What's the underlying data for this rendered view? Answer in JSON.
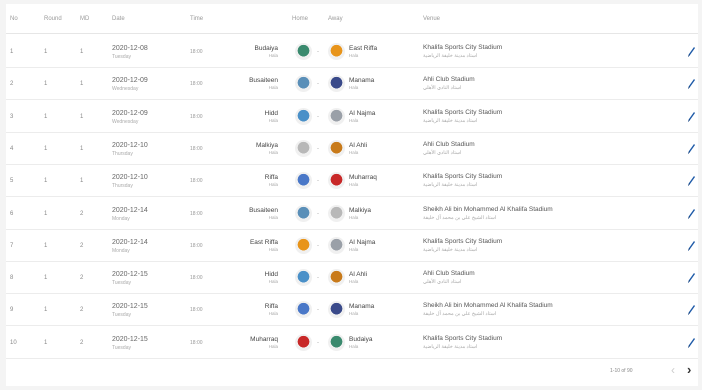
{
  "header": {
    "no": "No",
    "round": "Round",
    "md": "MD",
    "date": "Date",
    "time": "Time",
    "home": "Home",
    "away": "Away",
    "venue": "Venue"
  },
  "rows": [
    {
      "no": "1",
      "round": "1",
      "md": "1",
      "date": "2020-12-08",
      "day": "Tuesday",
      "time": "18:00",
      "home": "Budaiya",
      "home_sub": "Hala",
      "away": "East Riffa",
      "away_sub": "Hala",
      "venue": "Khalifa Sports City Stadium",
      "venue_sub": "استاد مدينة خليفة الرياضية",
      "home_color": "#3a8a6e",
      "away_color": "#e8941a"
    },
    {
      "no": "2",
      "round": "1",
      "md": "1",
      "date": "2020-12-09",
      "day": "Wednesday",
      "time": "18:00",
      "home": "Busaiteen",
      "home_sub": "Hala",
      "away": "Manama",
      "away_sub": "Hala",
      "venue": "Ahli Club Stadium",
      "venue_sub": "استاد النادي الأهلي",
      "home_color": "#5a8fb8",
      "away_color": "#3a4a8a"
    },
    {
      "no": "3",
      "round": "1",
      "md": "1",
      "date": "2020-12-09",
      "day": "Wednesday",
      "time": "18:00",
      "home": "Hidd",
      "home_sub": "Hala",
      "away": "Al Najma",
      "away_sub": "Hala",
      "venue": "Khalifa Sports City Stadium",
      "venue_sub": "استاد مدينة خليفة الرياضية",
      "home_color": "#4a90c8",
      "away_color": "#9aa0a8"
    },
    {
      "no": "4",
      "round": "1",
      "md": "1",
      "date": "2020-12-10",
      "day": "Thursday",
      "time": "18:00",
      "home": "Malkiya",
      "home_sub": "Hala",
      "away": "Al Ahli",
      "away_sub": "Hala",
      "venue": "Ahli Club Stadium",
      "venue_sub": "استاد النادي الأهلي",
      "home_color": "#b8b8b8",
      "away_color": "#c87a1a"
    },
    {
      "no": "5",
      "round": "1",
      "md": "1",
      "date": "2020-12-10",
      "day": "Thursday",
      "time": "18:00",
      "home": "Riffa",
      "home_sub": "Hala",
      "away": "Muharraq",
      "away_sub": "Hala",
      "venue": "Khalifa Sports City Stadium",
      "venue_sub": "استاد مدينة خليفة الرياضية",
      "home_color": "#4a78c8",
      "away_color": "#c82828"
    },
    {
      "no": "6",
      "round": "1",
      "md": "2",
      "date": "2020-12-14",
      "day": "Monday",
      "time": "18:00",
      "home": "Busaiteen",
      "home_sub": "Hala",
      "away": "Malkiya",
      "away_sub": "Hala",
      "venue": "Sheikh Ali bin Mohammed Al Khalifa Stadium",
      "venue_sub": "استاد الشيخ علي بن محمد آل خليفة",
      "home_color": "#5a8fb8",
      "away_color": "#b8b8b8"
    },
    {
      "no": "7",
      "round": "1",
      "md": "2",
      "date": "2020-12-14",
      "day": "Monday",
      "time": "18:00",
      "home": "East Riffa",
      "home_sub": "Hala",
      "away": "Al Najma",
      "away_sub": "Hala",
      "venue": "Khalifa Sports City Stadium",
      "venue_sub": "استاد مدينة خليفة الرياضية",
      "home_color": "#e8941a",
      "away_color": "#9aa0a8"
    },
    {
      "no": "8",
      "round": "1",
      "md": "2",
      "date": "2020-12-15",
      "day": "Tuesday",
      "time": "18:00",
      "home": "Hidd",
      "home_sub": "Hala",
      "away": "Al Ahli",
      "away_sub": "Hala",
      "venue": "Ahli Club Stadium",
      "venue_sub": "استاد النادي الأهلي",
      "home_color": "#4a90c8",
      "away_color": "#c87a1a"
    },
    {
      "no": "9",
      "round": "1",
      "md": "2",
      "date": "2020-12-15",
      "day": "Tuesday",
      "time": "18:00",
      "home": "Riffa",
      "home_sub": "Hala",
      "away": "Manama",
      "away_sub": "Hala",
      "venue": "Sheikh Ali bin Mohammed Al Khalifa Stadium",
      "venue_sub": "استاد الشيخ علي بن محمد آل خليفة",
      "home_color": "#4a78c8",
      "away_color": "#3a4a8a"
    },
    {
      "no": "10",
      "round": "1",
      "md": "2",
      "date": "2020-12-15",
      "day": "Tuesday",
      "time": "18:00",
      "home": "Muharraq",
      "home_sub": "Hala",
      "away": "Budaiya",
      "away_sub": "Hala",
      "venue": "Khalifa Sports City Stadium",
      "venue_sub": "استاد مدينة خليفة الرياضية",
      "home_color": "#c82828",
      "away_color": "#3a8a6e"
    }
  ],
  "pagination": {
    "label": "1-10 of 90",
    "prev_icon": "chevron-left-icon",
    "next_icon": "chevron-right-icon"
  },
  "icons": {
    "edit": "pencil-icon"
  },
  "colors": {
    "edit": "#1e5aa8",
    "border": "#ececec"
  }
}
